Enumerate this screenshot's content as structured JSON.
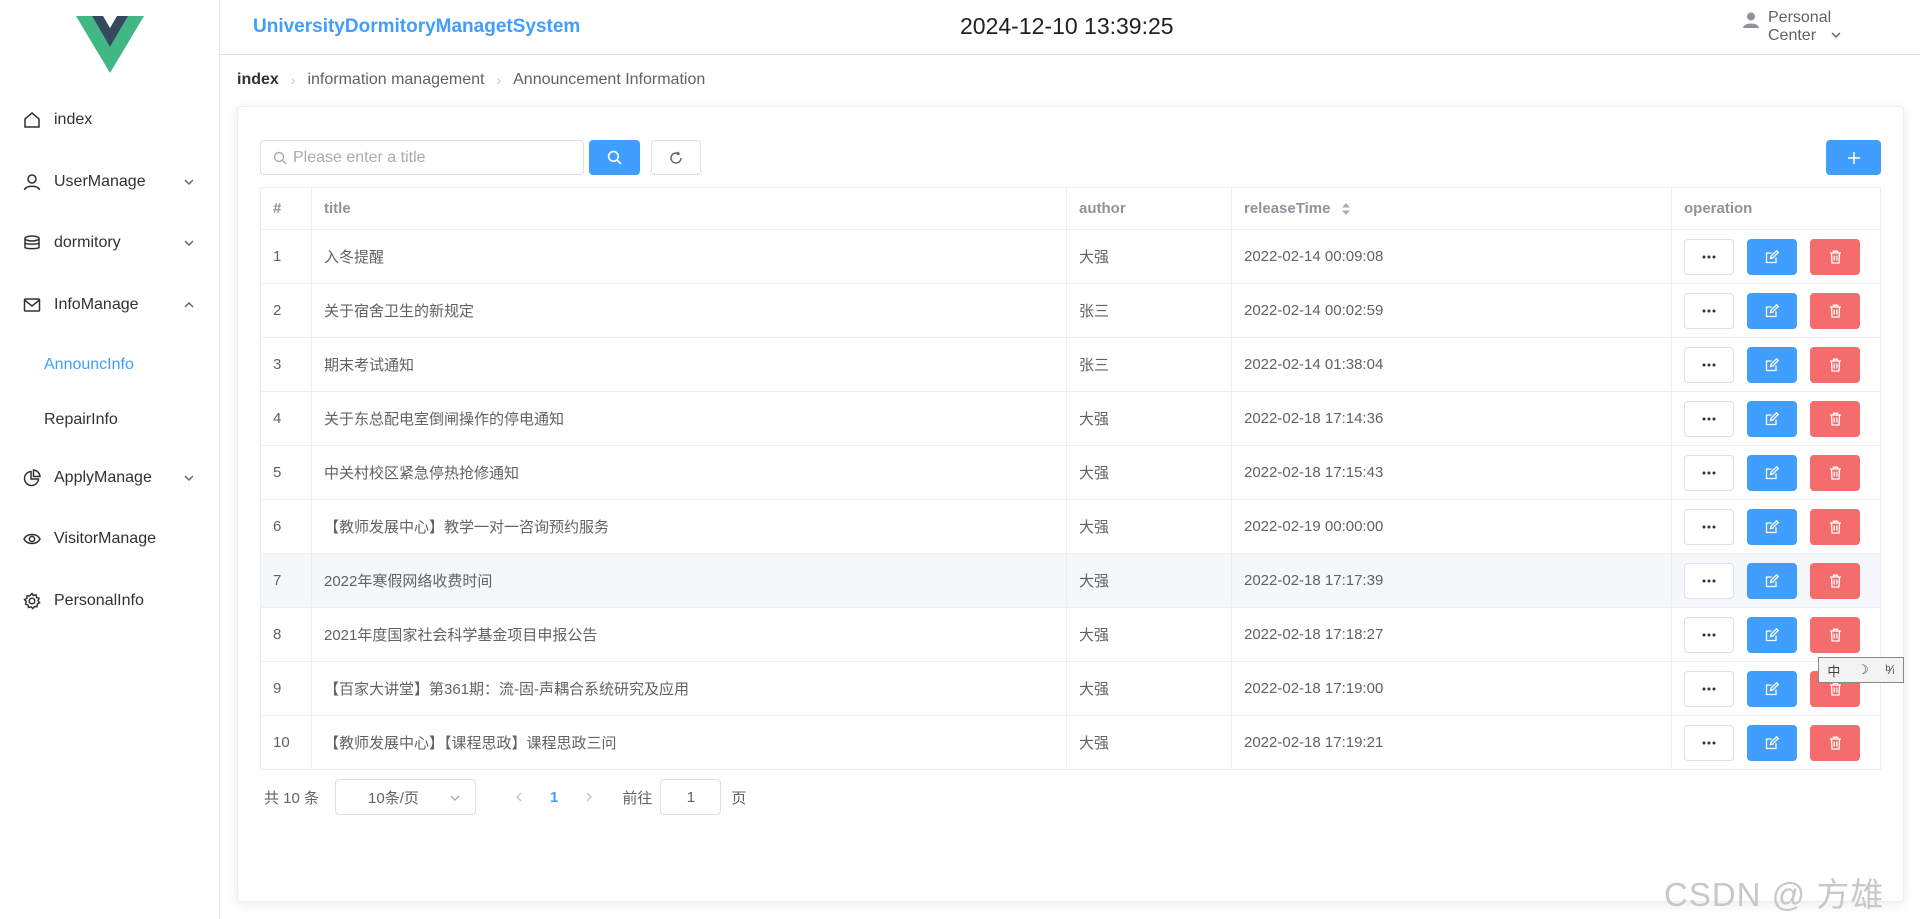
{
  "app": {
    "title": "UniversityDormitoryManagetSystem",
    "datetime": "2024-12-10 13:39:25",
    "user_menu": "Personal Center",
    "accent": "#409eff",
    "danger": "#f56c6c",
    "logo_colors": [
      "#41b883",
      "#35495e"
    ]
  },
  "sidebar": {
    "items": [
      {
        "label": "index",
        "icon": "home-icon"
      },
      {
        "label": "UserManage",
        "icon": "user-icon",
        "expandable": true
      },
      {
        "label": "dormitory",
        "icon": "coin-icon",
        "expandable": true
      },
      {
        "label": "InfoManage",
        "icon": "message-icon",
        "expandable": true,
        "expanded": true
      },
      {
        "label": "ApplyManage",
        "icon": "pie-chart-icon",
        "expandable": true
      },
      {
        "label": "VisitorManage",
        "icon": "view-icon"
      },
      {
        "label": "PersonalInfo",
        "icon": "setting-icon"
      }
    ],
    "sub_items": [
      {
        "label": "AnnouncInfo",
        "active": true
      },
      {
        "label": "RepairInfo",
        "active": false
      }
    ]
  },
  "breadcrumb": [
    "index",
    "information management",
    "Announcement Information"
  ],
  "search": {
    "placeholder": "Please enter a title",
    "value": ""
  },
  "table": {
    "columns": [
      "#",
      "title",
      "author",
      "releaseTime",
      "operation"
    ],
    "rows": [
      {
        "no": "1",
        "title": "入冬提醒",
        "author": "大强",
        "time": "2022-02-14 00:09:08"
      },
      {
        "no": "2",
        "title": "关于宿舍卫生的新规定",
        "author": "张三",
        "time": "2022-02-14 00:02:59"
      },
      {
        "no": "3",
        "title": "期末考试通知",
        "author": "张三",
        "time": "2022-02-14 01:38:04"
      },
      {
        "no": "4",
        "title": "关于东总配电室倒闸操作的停电通知",
        "author": "大强",
        "time": "2022-02-18 17:14:36"
      },
      {
        "no": "5",
        "title": "中关村校区紧急停热抢修通知",
        "author": "大强",
        "time": "2022-02-18 17:15:43"
      },
      {
        "no": "6",
        "title": "【教师发展中心】教学一对一咨询预约服务",
        "author": "大强",
        "time": "2022-02-19 00:00:00"
      },
      {
        "no": "7",
        "title": "2022年寒假网络收费时间",
        "author": "大强",
        "time": "2022-02-18 17:17:39"
      },
      {
        "no": "8",
        "title": "2021年度国家社会科学基金项目申报公告",
        "author": "大强",
        "time": "2022-02-18 17:18:27"
      },
      {
        "no": "9",
        "title": "【百家大讲堂】第361期：流-固-声耦合系统研究及应用",
        "author": "大强",
        "time": "2022-02-18 17:19:00"
      },
      {
        "no": "10",
        "title": "【教师发展中心】【课程思政】课程思政三问",
        "author": "大强",
        "time": "2022-02-18 17:19:21"
      }
    ]
  },
  "pagination": {
    "total_text": "共 10 条",
    "page_size": "10条/页",
    "current_page": "1",
    "goto_label": "前往",
    "goto_value": "1",
    "page_suffix": "页"
  },
  "ime": {
    "chars": [
      "中",
      "☽",
      "ᵇ⁄ₗ"
    ]
  },
  "watermark": "CSDN @ 方雄"
}
